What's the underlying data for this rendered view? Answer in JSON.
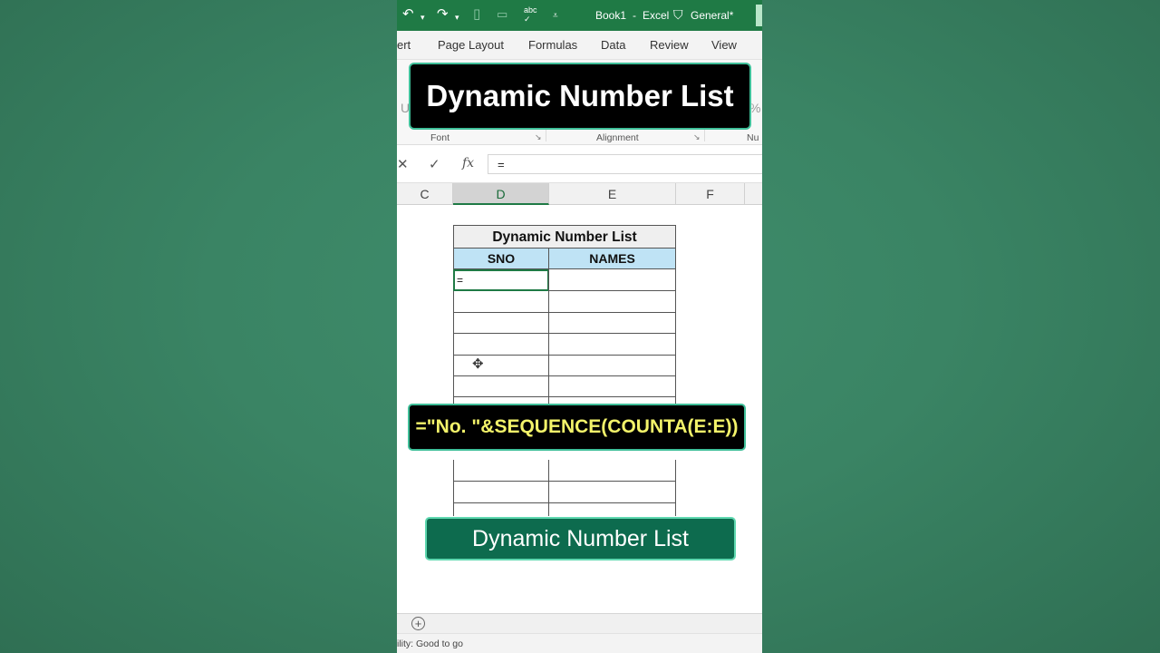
{
  "titlebar": {
    "undo_icon": "undo-icon",
    "redo_icon": "redo-icon",
    "spelling_label": "abc",
    "doc_title": "Book1",
    "separator": "-",
    "app_name": "Excel",
    "sensitivity_label": "General*"
  },
  "ribbon": {
    "tabs": [
      "ert",
      "Page Layout",
      "Formulas",
      "Data",
      "Review",
      "View"
    ],
    "groups": [
      "Font",
      "Alignment",
      "Nu"
    ]
  },
  "formula_bar": {
    "cancel_icon": "close-icon",
    "enter_icon": "check-icon",
    "fx_label": "fx",
    "value": "="
  },
  "columns": [
    "C",
    "D",
    "E",
    "F"
  ],
  "active_column": "D",
  "table": {
    "title": "Dynamic Number List",
    "headers": [
      "SNO",
      "NAMES"
    ],
    "active_cell_value": "="
  },
  "overlays": {
    "top_title": "Dynamic Number List",
    "formula": "=\"No. \"&SEQUENCE(COUNTA(E:E))",
    "bottom_title": "Dynamic Number List"
  },
  "statusbar": {
    "text": "ility: Good to go"
  },
  "colors": {
    "excel_green": "#1f7a45",
    "header_blue": "#bfe3f5",
    "formula_yellow": "#f3f36a",
    "banner_border": "#3fbf99"
  }
}
